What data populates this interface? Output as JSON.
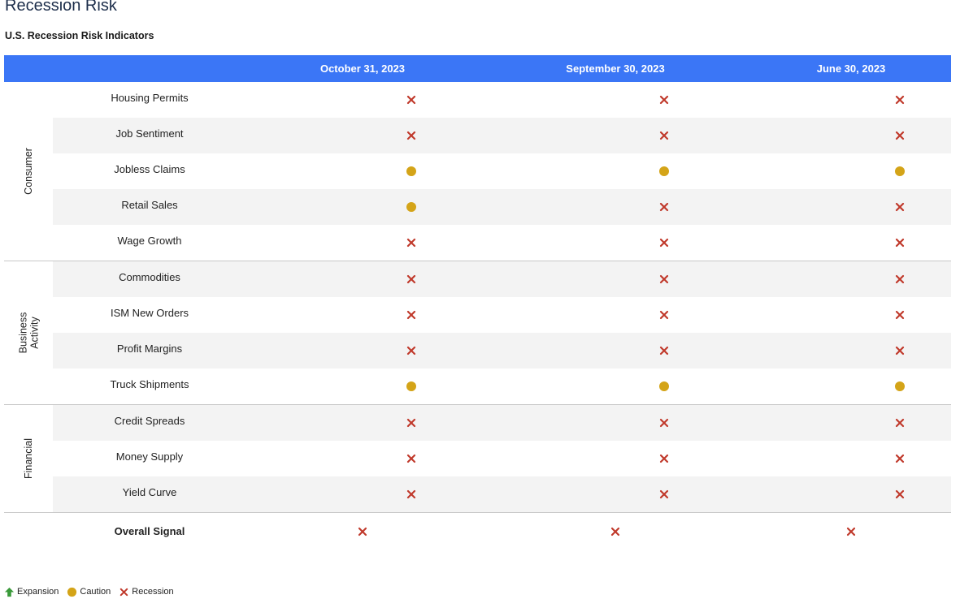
{
  "page_title": "Recession Risk",
  "subtitle": "U.S. Recession Risk Indicators",
  "colors": {
    "header_bg": "#3b76f6",
    "recession": "#c0392b",
    "caution": "#d4a418",
    "expansion": "#3a9a3a"
  },
  "chart_data": {
    "type": "table",
    "title": "U.S. Recession Risk Indicators",
    "columns": [
      "October 31, 2023",
      "September 30, 2023",
      "June 30, 2023"
    ],
    "groups": [
      {
        "label": "Consumer",
        "rows": [
          {
            "indicator": "Housing Permits",
            "signals": [
              "recession",
              "recession",
              "recession"
            ]
          },
          {
            "indicator": "Job Sentiment",
            "signals": [
              "recession",
              "recession",
              "recession"
            ]
          },
          {
            "indicator": "Jobless Claims",
            "signals": [
              "caution",
              "caution",
              "caution"
            ]
          },
          {
            "indicator": "Retail Sales",
            "signals": [
              "caution",
              "recession",
              "recession"
            ]
          },
          {
            "indicator": "Wage Growth",
            "signals": [
              "recession",
              "recession",
              "recession"
            ]
          }
        ]
      },
      {
        "label": "Business Activity",
        "rows": [
          {
            "indicator": "Commodities",
            "signals": [
              "recession",
              "recession",
              "recession"
            ]
          },
          {
            "indicator": "ISM New Orders",
            "signals": [
              "recession",
              "recession",
              "recession"
            ]
          },
          {
            "indicator": "Profit Margins",
            "signals": [
              "recession",
              "recession",
              "recession"
            ]
          },
          {
            "indicator": "Truck Shipments",
            "signals": [
              "caution",
              "caution",
              "caution"
            ]
          }
        ]
      },
      {
        "label": "Financial",
        "rows": [
          {
            "indicator": "Credit Spreads",
            "signals": [
              "recession",
              "recession",
              "recession"
            ]
          },
          {
            "indicator": "Money Supply",
            "signals": [
              "recession",
              "recession",
              "recession"
            ]
          },
          {
            "indicator": "Yield Curve",
            "signals": [
              "recession",
              "recession",
              "recession"
            ]
          }
        ]
      }
    ],
    "overall": {
      "indicator": "Overall Signal",
      "signals": [
        "recession",
        "recession",
        "recession"
      ]
    }
  },
  "legend": [
    {
      "key": "expansion",
      "label": "Expansion",
      "icon": "up-arrow-icon"
    },
    {
      "key": "caution",
      "label": "Caution",
      "icon": "dot-icon"
    },
    {
      "key": "recession",
      "label": "Recession",
      "icon": "x-icon"
    }
  ]
}
